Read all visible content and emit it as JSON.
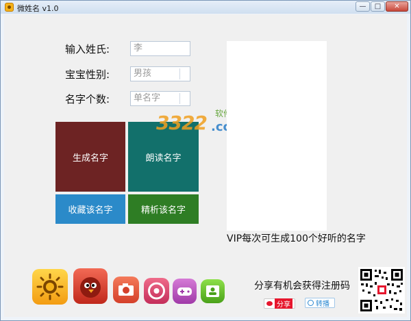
{
  "window": {
    "title": "微姓名 v1.0",
    "controls": {
      "minimize": "—",
      "maximize": "□",
      "close": "✕"
    }
  },
  "form": {
    "surname_label": "输入姓氏:",
    "surname_value": "李",
    "gender_label": "宝宝性别:",
    "gender_value": "男孩",
    "count_label": "名字个数:",
    "count_value": "单名字"
  },
  "tiles": {
    "generate": "生成名字",
    "read_aloud": "朗读名字",
    "collect": "收藏该名字",
    "analyze": "精析该名字"
  },
  "vip_text": "VIP每次可生成100个好听的名字",
  "watermark": {
    "number": "3322",
    "tld": ".cc",
    "site_label": "软件站"
  },
  "share": {
    "text": "分享有机会获得注册码",
    "weibo_label": "分享",
    "tencent_label": "转播"
  },
  "colors": {
    "tile_generate": "#6d2323",
    "tile_read": "#12706b",
    "tile_collect": "#2b8ac9",
    "tile_analyze": "#2e7d24"
  },
  "apps": [
    {
      "name": "sun-app-icon"
    },
    {
      "name": "angry-bird-app-icon"
    },
    {
      "name": "camera-app-icon"
    },
    {
      "name": "chrome-app-icon"
    },
    {
      "name": "gamepad-app-icon"
    },
    {
      "name": "contacts-app-icon"
    }
  ]
}
